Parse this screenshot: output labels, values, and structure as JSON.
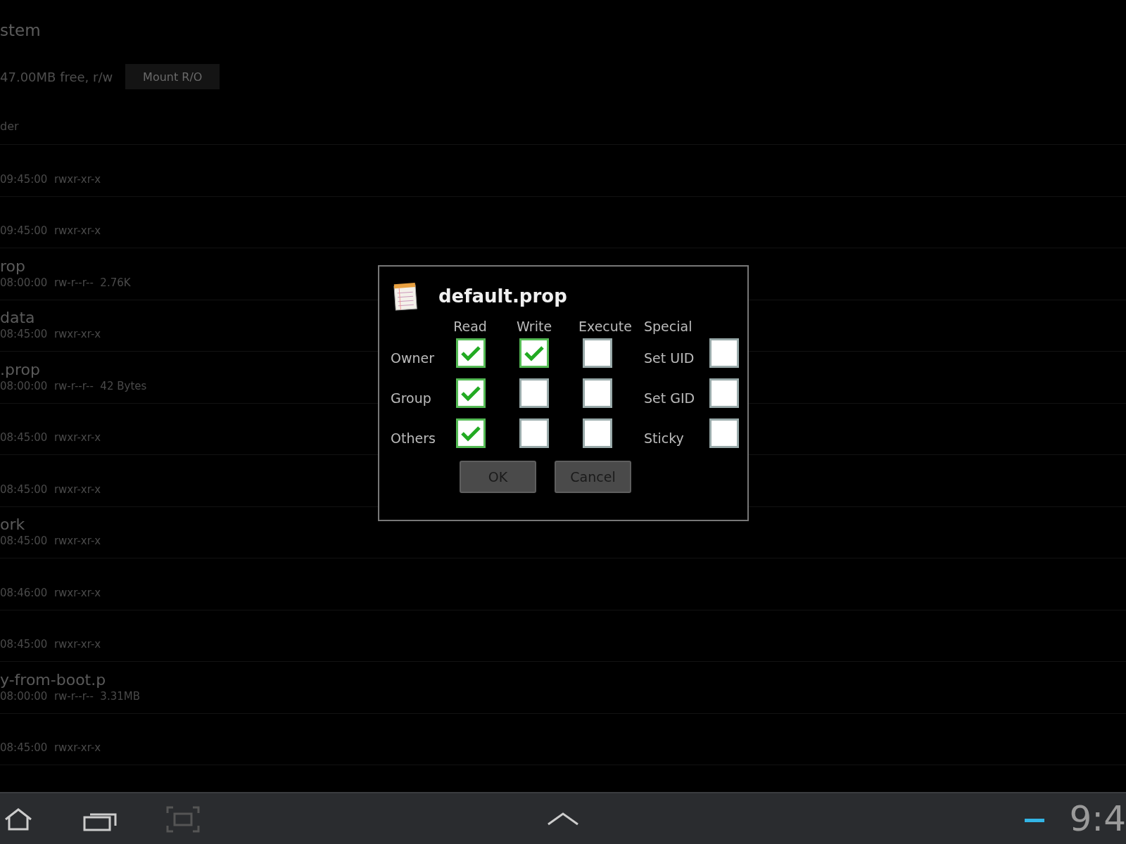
{
  "header": {
    "title": "stem",
    "info": "47.00MB free, r/w",
    "mount_button": "Mount R/O",
    "subtitle": "der"
  },
  "files": [
    {
      "details": "09:45:00  rwxr-xr-x"
    },
    {
      "details": "09:45:00  rwxr-xr-x"
    },
    {
      "name": "rop",
      "details": "08:00:00  rw-r--r--  2.76K"
    },
    {
      "name": "data",
      "details": "08:45:00  rwxr-xr-x"
    },
    {
      "name": ".prop",
      "details": "08:00:00  rw-r--r--  42 Bytes"
    },
    {
      "details": "08:45:00  rwxr-xr-x"
    },
    {
      "details": "08:45:00  rwxr-xr-x"
    },
    {
      "name": "ork",
      "details": "08:45:00  rwxr-xr-x"
    },
    {
      "details": "08:46:00  rwxr-xr-x"
    },
    {
      "details": "08:45:00  rwxr-xr-x"
    },
    {
      "name": "y-from-boot.p",
      "details": "08:00:00  rw-r--r--  3.31MB"
    },
    {
      "details": "08:45:00  rwxr-xr-x"
    }
  ],
  "dialog": {
    "title": "default.prop",
    "columns": [
      "Read",
      "Write",
      "Execute",
      "Special"
    ],
    "rows": [
      {
        "label": "Owner",
        "checks": [
          true,
          true,
          false
        ],
        "special_label": "Set UID",
        "special_checked": false
      },
      {
        "label": "Group",
        "checks": [
          true,
          false,
          false
        ],
        "special_label": "Set GID",
        "special_checked": false
      },
      {
        "label": "Others",
        "checks": [
          true,
          false,
          false
        ],
        "special_label": "Sticky",
        "special_checked": false
      }
    ],
    "buttons": [
      "OK",
      "Cancel"
    ]
  },
  "status_bar": {
    "clock": "9:4"
  }
}
